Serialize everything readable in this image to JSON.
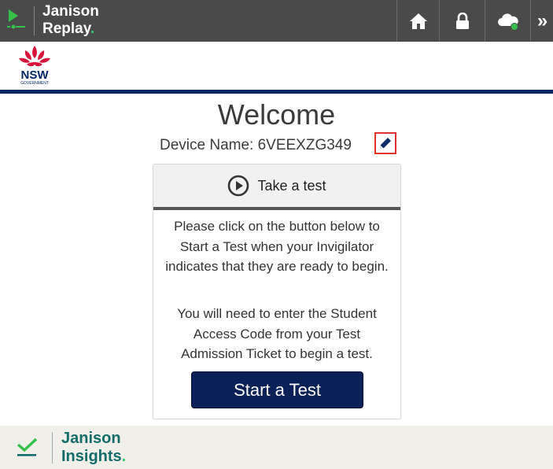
{
  "topbar": {
    "brand_line1": "Janison",
    "brand_line2": "Replay",
    "brand_dot": ".",
    "more_glyph": "»",
    "icons": [
      "replay-logo-icon",
      "home-icon",
      "lock-icon",
      "cloud-icon",
      "double-chevron-icon"
    ],
    "status_color": "#35c04a"
  },
  "header": {
    "logo_text": "NSW",
    "logo_subtext": "GOVERNMENT",
    "rule_color": "#002664"
  },
  "main": {
    "title": "Welcome",
    "device_label": "Device Name: 6VEEXZG349",
    "edit_icon": "pencil-icon"
  },
  "panel": {
    "header_label": "Take a test",
    "header_icon": "play-circle-icon",
    "paragraph1": "Please click on the button below to Start a Test when your Invigilator indicates that they are ready to begin.",
    "paragraph2": "You will need to enter the Student Access Code from your Test Admission Ticket to begin a test.",
    "start_label": "Start a Test",
    "button_color": "#0a2158"
  },
  "footer": {
    "brand_line1": "Janison",
    "brand_line2": "Insights",
    "brand_dot": ".",
    "icon": "checkmark-icon"
  }
}
